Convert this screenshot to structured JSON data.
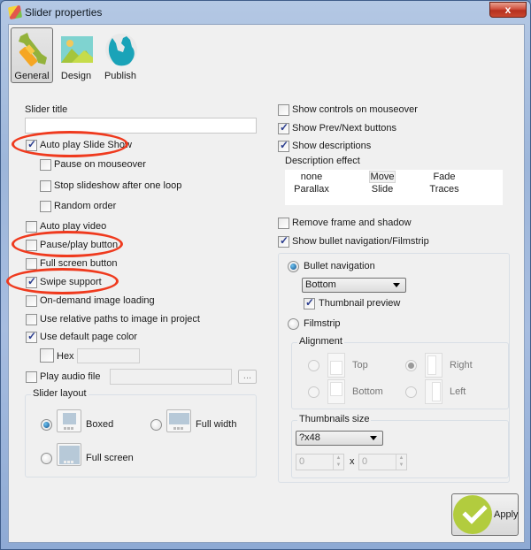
{
  "window": {
    "title": "Slider properties",
    "close_label": "x"
  },
  "tabs": [
    {
      "label": "General",
      "icon": "wrench-icon",
      "active": true
    },
    {
      "label": "Design",
      "icon": "landscape-icon",
      "active": false
    },
    {
      "label": "Publish",
      "icon": "globe-icon",
      "active": false
    }
  ],
  "left": {
    "slider_title_label": "Slider title",
    "slider_title_value": "",
    "auto_play": {
      "label": "Auto play Slide Show",
      "checked": true
    },
    "pause_on_mouseover": {
      "label": "Pause on mouseover",
      "checked": false
    },
    "stop_after_loop": {
      "label": "Stop slideshow after one loop",
      "checked": false
    },
    "random_order": {
      "label": "Random order",
      "checked": false
    },
    "auto_play_video": {
      "label": "Auto play video",
      "checked": false
    },
    "pause_play_button": {
      "label": "Pause/play button",
      "checked": false
    },
    "full_screen_button": {
      "label": "Full screen button",
      "checked": false
    },
    "swipe_support": {
      "label": "Swipe support",
      "checked": true
    },
    "on_demand_loading": {
      "label": "On-demand image loading",
      "checked": false
    },
    "relative_paths": {
      "label": "Use relative paths to image in project",
      "checked": false
    },
    "default_page_color": {
      "label": "Use default page color",
      "checked": true
    },
    "hex": {
      "label": "Hex",
      "value": ""
    },
    "play_audio": {
      "label": "Play audio file",
      "checked": false,
      "value": "",
      "browse_label": "..."
    },
    "slider_layout": {
      "title": "Slider layout",
      "options": [
        {
          "label": "Boxed",
          "selected": true
        },
        {
          "label": "Full width",
          "selected": false
        },
        {
          "label": "Full screen",
          "selected": false
        }
      ]
    }
  },
  "right": {
    "show_controls_mouseover": {
      "label": "Show controls on mouseover",
      "checked": false
    },
    "show_prev_next": {
      "label": "Show Prev/Next buttons",
      "checked": true
    },
    "show_descriptions": {
      "label": "Show descriptions",
      "checked": true
    },
    "description_effect": {
      "label": "Description effect",
      "options": [
        "none",
        "Move",
        "Fade",
        "Parallax",
        "Slide",
        "Traces"
      ],
      "selected": "Move"
    },
    "remove_frame": {
      "label": "Remove frame and shadow",
      "checked": false
    },
    "show_bullet_nav": {
      "label": "Show bullet navigation/Filmstrip",
      "checked": true
    },
    "bullet_navigation": {
      "label": "Bullet navigation",
      "selected": true,
      "position": "Bottom"
    },
    "thumbnail_preview": {
      "label": "Thumbnail preview",
      "checked": true
    },
    "filmstrip": {
      "label": "Filmstrip",
      "selected": false
    },
    "alignment": {
      "title": "Alignment",
      "options": [
        {
          "label": "Top",
          "selected": false
        },
        {
          "label": "Right",
          "selected": true
        },
        {
          "label": "Bottom",
          "selected": false
        },
        {
          "label": "Left",
          "selected": false
        }
      ]
    },
    "thumbnails_size": {
      "title": "Thumbnails size",
      "preset": "?x48",
      "width": "0",
      "height": "0",
      "separator": "x"
    }
  },
  "footer": {
    "apply_label": "Apply"
  },
  "colors": {
    "accent_green": "#b2cc3e",
    "highlight_red": "#ef3a1e",
    "check_blue": "#2a3d8f"
  }
}
